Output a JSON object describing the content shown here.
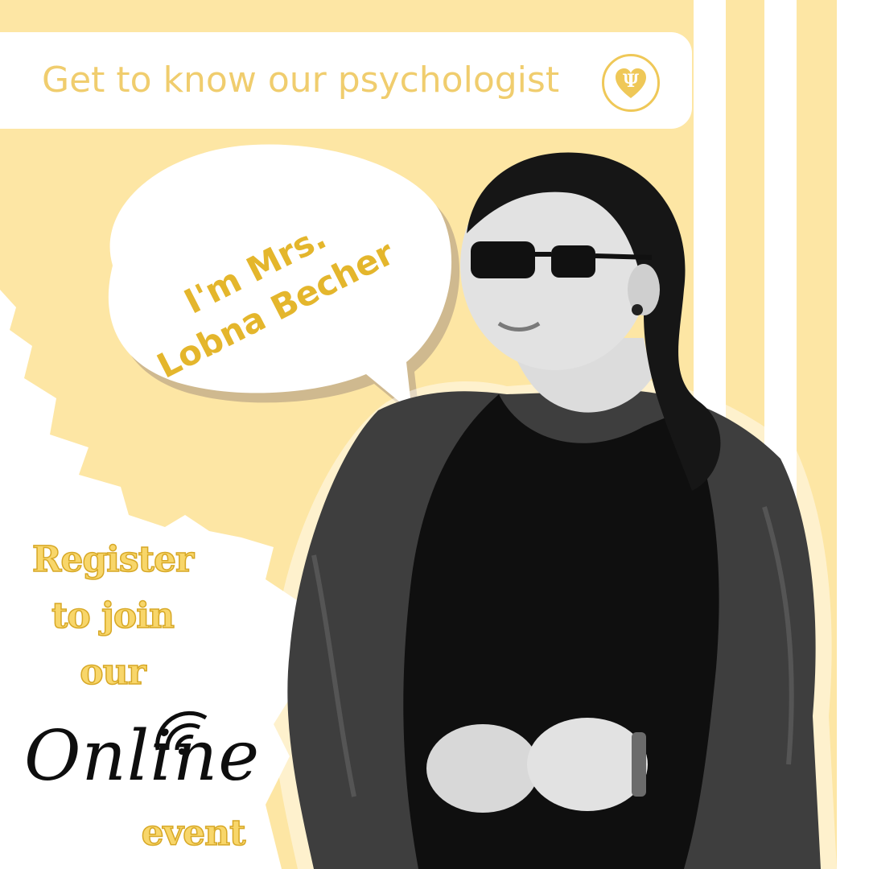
{
  "header": {
    "title": "Get to know our psychologist",
    "logo_icon": "psi-heart-icon"
  },
  "bubble": {
    "line1": "I'm Mrs.",
    "line2": "Lobna Becher"
  },
  "cta": {
    "line1": "Register",
    "line2": "to join",
    "line3": "our",
    "line4": "Online",
    "line5": "event",
    "wifi_icon": "wifi-signal-icon"
  },
  "colors": {
    "background": "#fde6a4",
    "accent": "#f0cd6e",
    "accent_dark": "#e4b62c",
    "white": "#ffffff",
    "ink": "#0e0e0e"
  },
  "photo": {
    "subject": "person-photo"
  }
}
